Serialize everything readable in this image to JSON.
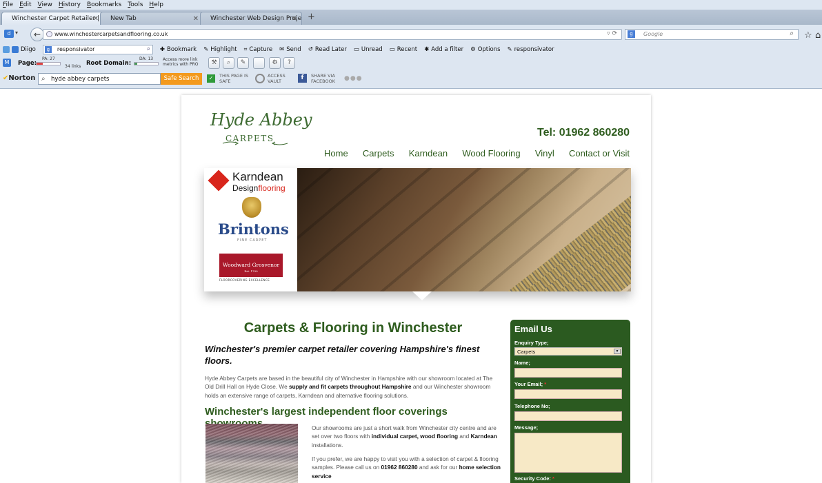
{
  "browser": {
    "menu": [
      "File",
      "Edit",
      "View",
      "History",
      "Bookmarks",
      "Tools",
      "Help"
    ],
    "tabs": [
      {
        "label": "Winchester Carpet Retailer | Ca..."
      },
      {
        "label": "New Tab"
      },
      {
        "label": "Winchester Web Design Project..."
      }
    ],
    "new_tab": "+",
    "url": "www.winchestercarpetsandflooring.co.uk",
    "search_placeholder": "Google"
  },
  "diigo": {
    "brand": "Diigo",
    "search_value": "responsivator",
    "items": [
      "Bookmark",
      "Highlight",
      "Capture",
      "Send",
      "Read Later",
      "Unread",
      "Recent",
      "Add a filter",
      "Options",
      "responsivator"
    ]
  },
  "moz": {
    "page_label": "Page:",
    "pa": "PA: 27",
    "links": "34 links",
    "root_label": "Root Domain:",
    "da": "DA: 13",
    "pro_note": "Access more link metrics with PRO"
  },
  "norton": {
    "brand": "Norton",
    "search_value": "hyde abbey carpets",
    "safe_search": "Safe Search",
    "safe_label": "THIS PAGE IS SAFE",
    "vault_label": "ACCESS VAULT",
    "share_label": "SHARE VIA FACEBOOK"
  },
  "site": {
    "logo_main": "Hyde Abbey",
    "logo_sub": "CARPETS",
    "tel": "Tel: 01962 860280",
    "nav": [
      "Home",
      "Carpets",
      "Karndean",
      "Wood Flooring",
      "Vinyl",
      "Contact or Visit"
    ],
    "brands": {
      "karndean": "Karndean",
      "karndean_sub_a": "Design",
      "karndean_sub_b": "flooring",
      "brintons": "Brintons",
      "brintons_sub": "FINE CARPET",
      "wg": "Woodward Grosvenor",
      "wg_est": "Est. 1790",
      "wg_sub": "FLOORCOVERING EXCELLENCE"
    },
    "h1": "Carpets & Flooring in Winchester",
    "lead": "Winchester's premier carpet retailer covering Hampshire's finest floors.",
    "p1_a": "Hyde Abbey Carpets are based in the beautiful city of Winchester in Hampshire with our showroom located at The Old Drill Hall on Hyde Close. We ",
    "p1_b": "supply and fit carpets throughout Hampshire",
    "p1_c": " and our Winchester showroom holds an extensive range of carpets, Karndean and alternative flooring solutions.",
    "h2": "Winchester's largest independent floor coverings showrooms",
    "p2_a": "Our showrooms are just a short walk from Winchester city centre and are set over two floors with ",
    "p2_b": "individual carpet, wood flooring",
    "p2_c": " and ",
    "p2_d": "Karndean",
    "p2_e": " installations.",
    "p3_a": "If you prefer, we are happy to visit you with a selection of carpet & flooring samples. Please call us on ",
    "p3_b": "01962 860280",
    "p3_c": " and ask for our ",
    "p3_d": "home selection service"
  },
  "form": {
    "title": "Email Us",
    "enquiry_label": "Enquiry Type;",
    "enquiry_value": "Carpets",
    "name_label": "Name;",
    "email_label": "Your Email;",
    "phone_label": "Telephone No;",
    "message_label": "Message;",
    "security_label": "Security Code:",
    "required_mark": "*"
  },
  "colors": {
    "brand_green": "#2e5c1e",
    "form_green": "#2b5a20",
    "field_bg": "#f7e9c6",
    "norton_orange": "#f39a1e"
  }
}
